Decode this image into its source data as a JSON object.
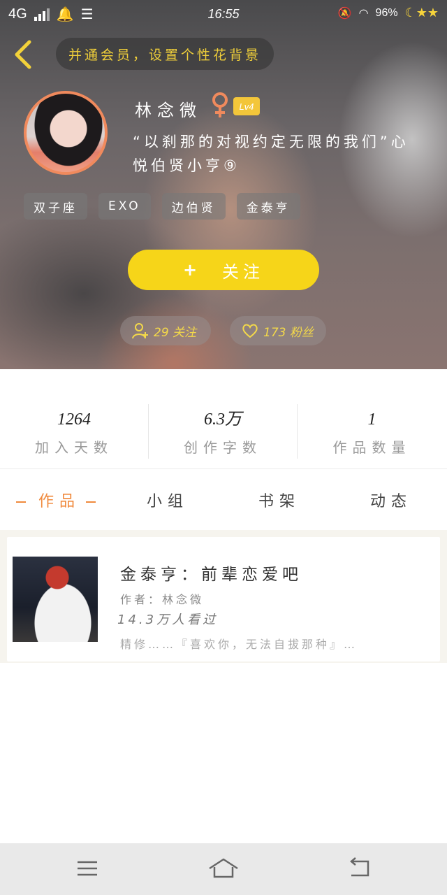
{
  "status_bar": {
    "network": "4G",
    "time": "16:55",
    "battery": "96%"
  },
  "header": {
    "set_background_label": "并通会员，设置个性花背景"
  },
  "profile": {
    "name": "林念微",
    "level": "Lv4",
    "signature": "“以刹那的对视约定无限的我们”心悦伯贤小亨⑨",
    "tags": [
      "双子座",
      "EXO",
      "边伯贤",
      "金泰亨"
    ],
    "follow_label": "关注",
    "following_count": "29 关注",
    "fans_count": "173 粉丝"
  },
  "stats": [
    {
      "value": "1264",
      "label": "加入天数"
    },
    {
      "value": "6.3万",
      "label": "创作字数"
    },
    {
      "value": "1",
      "label": "作品数量"
    }
  ],
  "tabs": [
    {
      "label": "作品",
      "active": true
    },
    {
      "label": "小组",
      "active": false
    },
    {
      "label": "书架",
      "active": false
    },
    {
      "label": "动态",
      "active": false
    }
  ],
  "works": [
    {
      "title": "金泰亨：前辈恋爱吧",
      "author": "作者：林念微",
      "views": "14.3万人看过",
      "excerpt": "精修……『喜欢你，无法自拔那种』…"
    }
  ],
  "colors": {
    "accent_yellow": "#f6d519",
    "tab_active": "#f08a3d",
    "gender": "#f08a5d"
  }
}
